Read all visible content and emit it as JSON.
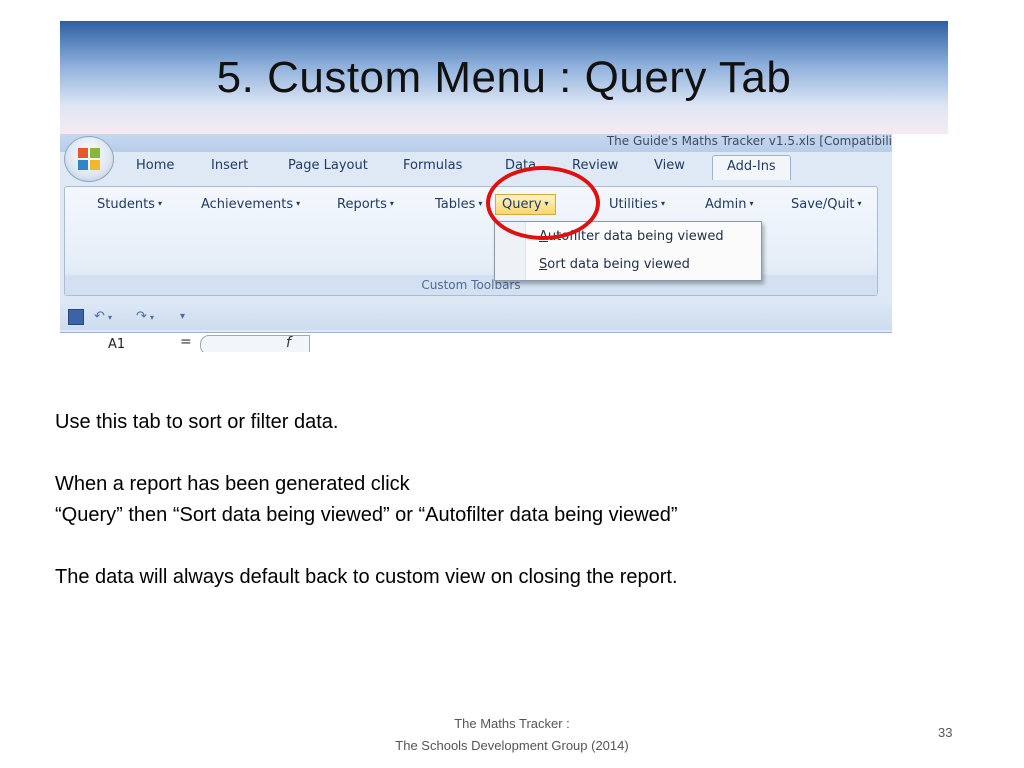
{
  "slide": {
    "title": "5.  Custom Menu :  Query Tab",
    "page_number": "33",
    "footer_line1": "The Maths Tracker :",
    "footer_line2": "The Schools Development Group  (2014)"
  },
  "excel": {
    "window_title": "The Guide's Maths Tracker v1.5.xls  [Compatibili",
    "tabs": [
      "Home",
      "Insert",
      "Page Layout",
      "Formulas",
      "Data",
      "Review",
      "View",
      "Add-Ins"
    ],
    "active_tab": "Add-Ins",
    "menu_items": [
      "Students",
      "Achievements",
      "Reports",
      "Tables",
      "Query",
      "Utilities",
      "Admin",
      "Save/Quit"
    ],
    "highlighted_menu": "Query",
    "group_label": "Custom Toolbars",
    "dropdown": {
      "option1_hotkey": "A",
      "option1_rest": "utofilter data being viewed",
      "option2_hotkey": "S",
      "option2_rest": "ort data being viewed"
    },
    "name_box": "A1",
    "formula_eq": "=",
    "fx_label": "f",
    "caret": "▾"
  },
  "body": {
    "line1": "Use this tab to sort or filter data.",
    "line2": "When a report has been generated click",
    "line3": "“Query” then “Sort data being viewed” or “Autofilter data being viewed”",
    "line4": "The data will always default back to custom view on closing the report."
  },
  "colors": {
    "highlight_ring": "#e01010",
    "title_gradient_top": "#2d5fa3",
    "ribbon_text": "#1f3a64"
  }
}
